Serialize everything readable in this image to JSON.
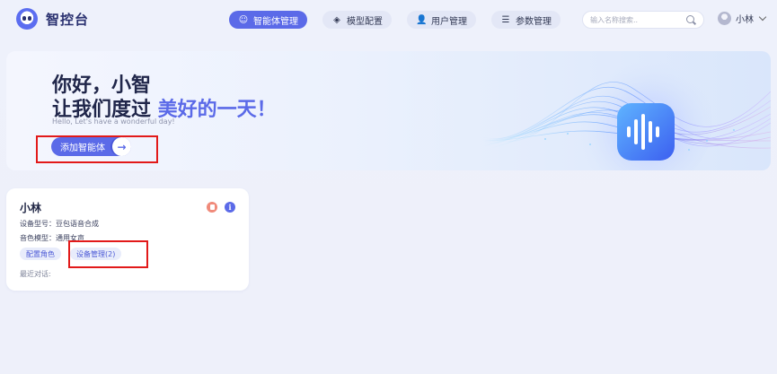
{
  "app": {
    "title": "智控台"
  },
  "nav": {
    "items": [
      {
        "label": "智能体管理",
        "icon": "robot-icon",
        "active": true
      },
      {
        "label": "模型配置",
        "icon": "cube-icon",
        "active": false
      },
      {
        "label": "用户管理",
        "icon": "users-icon",
        "active": false
      },
      {
        "label": "参数管理",
        "icon": "sliders-icon",
        "active": false
      }
    ]
  },
  "search": {
    "placeholder": "输入名称搜索..",
    "value": ""
  },
  "user": {
    "name": "小林"
  },
  "banner": {
    "greeting_line1": "你好，小智",
    "greeting_line2_prefix": "让我们度过 ",
    "greeting_line2_highlight": "美好的一天！",
    "subtitle": "Hello, Let's have a wonderful day!",
    "add_button_label": "添加智能体"
  },
  "agents": [
    {
      "name": "小林",
      "device_model": "设备型号：豆包语音合成",
      "voice_model": "音色模型：通用女声",
      "configure_label": "配置角色",
      "devices_label": "设备管理(2)",
      "recent_label": "最近对话:"
    }
  ],
  "colors": {
    "accent": "#5b6ae8",
    "highlight_box": "#e21a1a",
    "delete": "#f08a7a",
    "background": "#eef1fb"
  }
}
